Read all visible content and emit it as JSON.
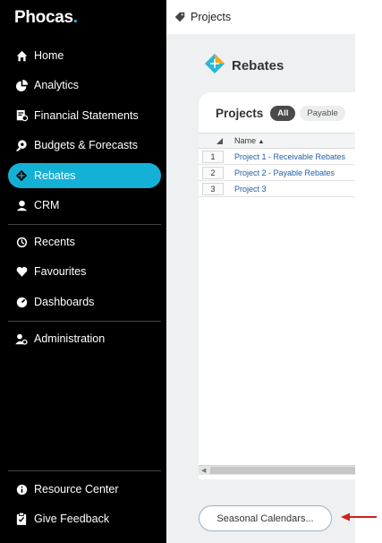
{
  "app": {
    "logo_text": "Phocas",
    "logo_dot": "."
  },
  "sidebar": {
    "items": [
      {
        "label": "Home",
        "icon": "home-icon"
      },
      {
        "label": "Analytics",
        "icon": "analytics-icon"
      },
      {
        "label": "Financial Statements",
        "icon": "financial-statements-icon"
      },
      {
        "label": "Budgets & Forecasts",
        "icon": "budgets-icon"
      },
      {
        "label": "Rebates",
        "icon": "rebates-icon",
        "active": true
      },
      {
        "label": "CRM",
        "icon": "crm-icon"
      },
      {
        "label": "Recents",
        "icon": "recents-icon"
      },
      {
        "label": "Favourites",
        "icon": "heart-icon"
      },
      {
        "label": "Dashboards",
        "icon": "dashboard-icon"
      },
      {
        "label": "Administration",
        "icon": "administration-icon"
      },
      {
        "label": "Resource Center",
        "icon": "info-icon"
      },
      {
        "label": "Give Feedback",
        "icon": "feedback-icon"
      }
    ]
  },
  "topbar": {
    "breadcrumb": "Projects"
  },
  "main": {
    "page_title": "Rebates",
    "card_title": "Projects",
    "filters": [
      "All",
      "Payable"
    ],
    "grid": {
      "column_header": "Name",
      "rows": [
        {
          "num": "1",
          "name": "Project 1 - Receivable Rebates"
        },
        {
          "num": "2",
          "name": "Project 2 - Payable Rebates"
        },
        {
          "num": "3",
          "name": "Project 3"
        }
      ]
    },
    "seasonal_button": "Seasonal Calendars..."
  },
  "colors": {
    "accent": "#14b1d6",
    "sidebar_bg": "#000000",
    "annotation_arrow": "#d31f1f"
  }
}
